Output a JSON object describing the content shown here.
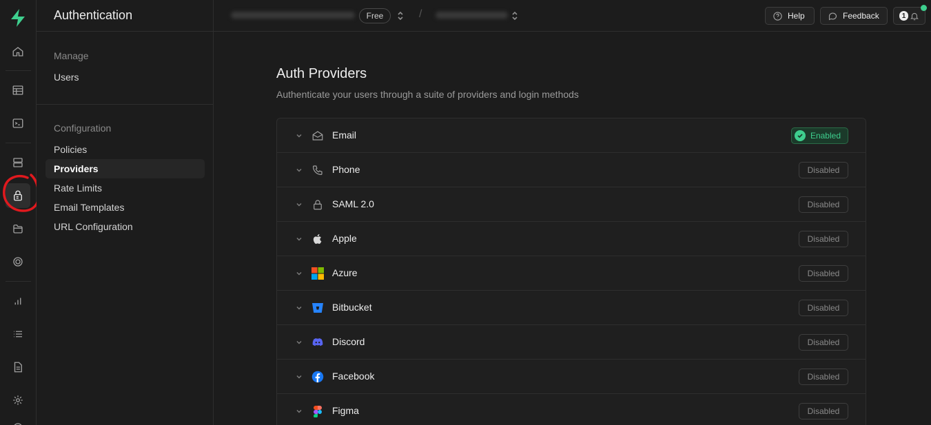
{
  "colors": {
    "brand": "#3ecf8e",
    "background": "#1c1c1c",
    "annotation": "#e0191e"
  },
  "rail": {
    "items": [
      {
        "icon": "home-icon"
      },
      {
        "icon": "table-editor-icon"
      },
      {
        "icon": "sql-editor-icon"
      },
      {
        "icon": "database-icon"
      },
      {
        "icon": "auth-lock-icon",
        "active": true
      },
      {
        "icon": "storage-icon"
      },
      {
        "icon": "realtime-icon"
      },
      {
        "icon": "reports-icon"
      },
      {
        "icon": "logs-icon"
      },
      {
        "icon": "api-docs-icon"
      },
      {
        "icon": "settings-icon"
      }
    ]
  },
  "subnav": {
    "title": "Authentication",
    "manage_label": "Manage",
    "manage_items": [
      "Users"
    ],
    "config_label": "Configuration",
    "config_items": [
      "Policies",
      "Providers",
      "Rate Limits",
      "Email Templates",
      "URL Configuration"
    ],
    "active": "Providers"
  },
  "topbar": {
    "plan_badge": "Free",
    "separator": "/",
    "help_label": "Help",
    "feedback_label": "Feedback",
    "notification_count": "1"
  },
  "page": {
    "title": "Auth Providers",
    "subtitle": "Authenticate your users through a suite of providers and login methods"
  },
  "providers": [
    {
      "name": "Email",
      "status": "Enabled",
      "icon": "mail-icon"
    },
    {
      "name": "Phone",
      "status": "Disabled",
      "icon": "phone-icon"
    },
    {
      "name": "SAML 2.0",
      "status": "Disabled",
      "icon": "lock-icon"
    },
    {
      "name": "Apple",
      "status": "Disabled",
      "icon": "apple-icon"
    },
    {
      "name": "Azure",
      "status": "Disabled",
      "icon": "azure-icon"
    },
    {
      "name": "Bitbucket",
      "status": "Disabled",
      "icon": "bitbucket-icon"
    },
    {
      "name": "Discord",
      "status": "Disabled",
      "icon": "discord-icon"
    },
    {
      "name": "Facebook",
      "status": "Disabled",
      "icon": "facebook-icon"
    },
    {
      "name": "Figma",
      "status": "Disabled",
      "icon": "figma-icon"
    }
  ]
}
